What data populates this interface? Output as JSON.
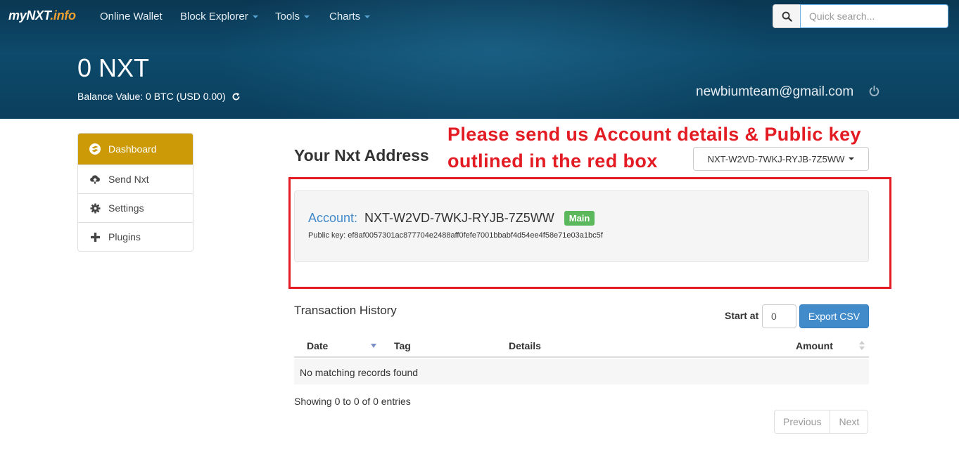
{
  "navbar": {
    "brand_main": "myNXT",
    "brand_accent": ".info",
    "items": [
      {
        "label": "Online Wallet",
        "dropdown": false
      },
      {
        "label": "Block Explorer",
        "dropdown": true
      },
      {
        "label": "Tools",
        "dropdown": true
      },
      {
        "label": "Charts",
        "dropdown": true
      }
    ],
    "search_placeholder": "Quick search...",
    "search_icon": "search-icon"
  },
  "header": {
    "balance": "0 NXT",
    "balance_value": "Balance Value: 0 BTC (USD 0.00)",
    "user_email": "newbiumteam@gmail.com"
  },
  "sidebar": {
    "items": [
      {
        "label": "Dashboard",
        "icon": "logo-icon",
        "active": true
      },
      {
        "label": "Send Nxt",
        "icon": "cloud-upload-icon",
        "active": false
      },
      {
        "label": "Settings",
        "icon": "gear-icon",
        "active": false
      },
      {
        "label": "Plugins",
        "icon": "plus-icon",
        "active": false
      }
    ]
  },
  "main": {
    "title": "Your Nxt Address",
    "address_select": "NXT-W2VD-7WKJ-RYJB-7Z5WW",
    "note": "Please send us Account details & Public key outlined in the red box",
    "account": {
      "label": "Account:",
      "id": "NXT-W2VD-7WKJ-RYJB-7Z5WW",
      "badge": "Main",
      "public_key": "Public key: ef8af0057301ac877704e2488aff0fefe7001bbabf4d54ee4f58e71e03a1bc5f"
    }
  },
  "transactions": {
    "title": "Transaction History",
    "start_at_label": "Start at",
    "start_at_value": "0",
    "export_label": "Export CSV",
    "columns": [
      "Date",
      "Tag",
      "Details",
      "Amount"
    ],
    "empty_text": "No matching records found",
    "info": "Showing 0 to 0 of 0 entries",
    "pager": {
      "previous": "Previous",
      "next": "Next"
    }
  },
  "colors": {
    "header_bg": "#0b3f5d",
    "active_sidebar": "#cc9a06",
    "primary_button": "#428bca",
    "badge_main": "#5cb85c",
    "annotation_red": "#e31b23",
    "brand_accent": "#f0a030"
  }
}
